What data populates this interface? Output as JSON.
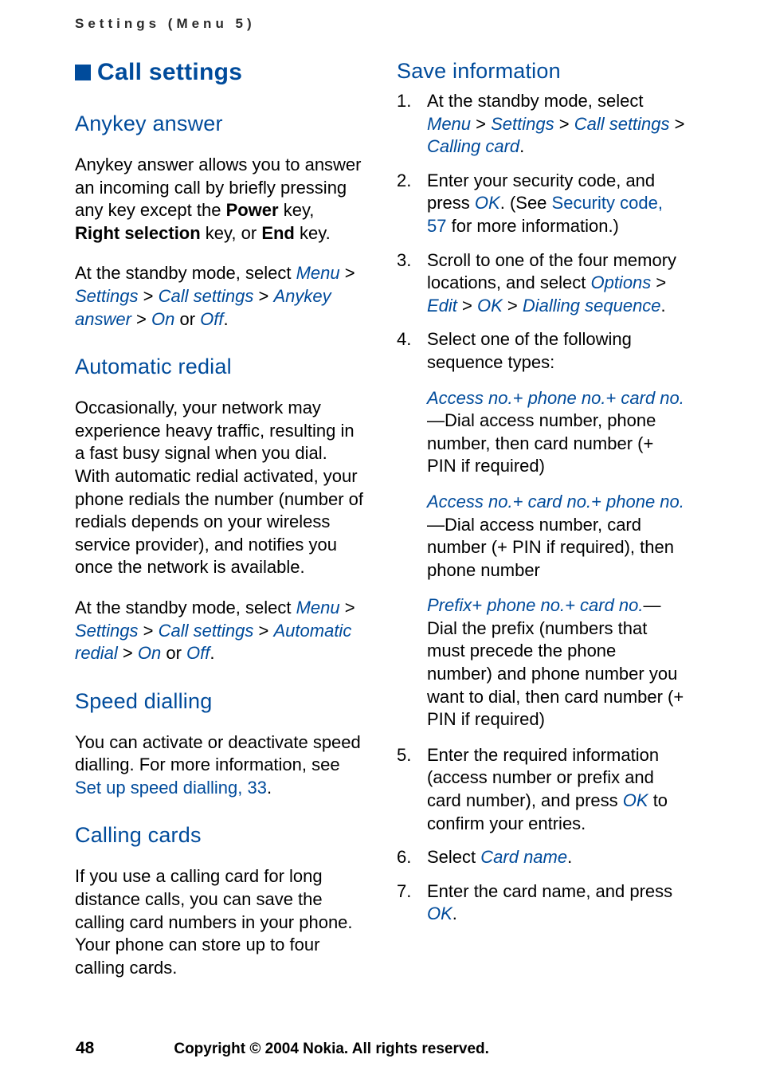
{
  "header": {
    "running": "Settings (Menu 5)"
  },
  "left": {
    "section_title": "Call settings",
    "anykey": {
      "heading": "Anykey answer",
      "para1_a": "Anykey answer allows you to answer an incoming call by briefly pressing any key except the ",
      "power": "Power",
      "para1_b": " key, ",
      "right_sel": "Right selection",
      "para1_c": " key, or ",
      "end": "End",
      "para1_d": " key.",
      "p2_lead": "At the standby mode, select ",
      "menu": "Menu",
      "gt1": " > ",
      "settings": "Settings",
      "gt2": " > ",
      "callsettings": "Call settings",
      "gt3": " > ",
      "anykey_answer": "Anykey answer",
      "gt4": " > ",
      "on": "On",
      "or": " or ",
      "off": "Off",
      "dot": "."
    },
    "auto": {
      "heading": "Automatic redial",
      "para1": "Occasionally, your network may experience heavy traffic, resulting in a fast busy signal when you dial. With automatic redial activated, your phone redials the number (number of redials depends on your wireless service provider), and notifies you once the network is available.",
      "p2_lead": "At the standby mode, select ",
      "menu": "Menu",
      "gt1": " > ",
      "settings": "Settings",
      "gt2": " > ",
      "callsettings": "Call settings",
      "gt3": " > ",
      "automatic_redial": "Automatic redial",
      "gt4": " > ",
      "on": "On",
      "or": " or ",
      "off": "Off",
      "dot": "."
    },
    "speed": {
      "heading": "Speed dialling",
      "lead": "You can activate or deactivate speed dialling. For more information, see ",
      "link": "Set up speed dialling, 33",
      "dot": "."
    },
    "cards": {
      "heading": "Calling cards",
      "para": "If you use a calling card for long distance calls, you can save the calling card numbers in your phone. Your phone can store up to four calling cards."
    }
  },
  "right": {
    "save_heading": "Save information",
    "li1_a": "At the standby mode, select ",
    "li1_menu": "Menu",
    "gt": " > ",
    "li1_settings": "Settings",
    "li1_callsettings": "Call settings",
    "li1_callingcard": "Calling card",
    "dot": ".",
    "li2_a": "Enter your security code, and press ",
    "li2_ok": "OK",
    "li2_b": ". (See ",
    "li2_link": "Security code, 57",
    "li2_c": " for more information.)",
    "li3_a": "Scroll to one of the four memory locations, and select ",
    "li3_options": "Options",
    "li3_edit": "Edit",
    "li3_ok": "OK",
    "li3_dial": "Dialling sequence",
    "li4": "Select one of the following sequence types:",
    "block1_title": "Access no.+ phone no.+ card no.",
    "block1_body": "—Dial access number, phone number, then card number (+ PIN if required)",
    "block2_title": "Access no.+ card no.+ phone no.",
    "block2_body": "—Dial access number, card number (+ PIN if required), then phone number",
    "block3_title": "Prefix+ phone no.+ card no.",
    "block3_body": "—Dial the prefix (numbers that must precede the phone number) and phone number you want to dial, then card number (+ PIN if required)",
    "li5_a": "Enter the required information (access number or prefix and card number), and press ",
    "li5_ok": "OK",
    "li5_b": " to confirm your entries.",
    "li6_a": "Select ",
    "li6_cardname": "Card name",
    "li7_a": "Enter the card name, and press ",
    "li7_ok": "OK"
  },
  "footer": {
    "page": "48",
    "copyright": "Copyright © 2004 Nokia. All rights reserved."
  }
}
